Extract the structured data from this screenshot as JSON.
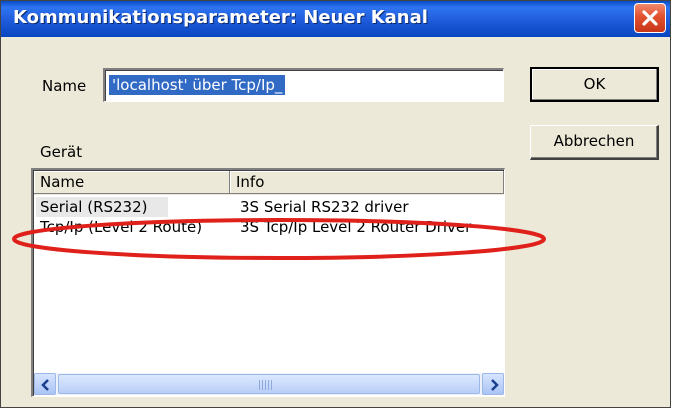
{
  "window": {
    "title": "Kommunikationsparameter: Neuer Kanal",
    "close_icon": "close-x-icon"
  },
  "form": {
    "name_label": "Name",
    "name_value": "'localhost' über Tcp/Ip_",
    "device_label": "Gerät"
  },
  "buttons": {
    "ok": "OK",
    "cancel": "Abbrechen"
  },
  "device_list": {
    "columns": [
      "Name",
      "Info"
    ],
    "rows": [
      {
        "name": "Serial (RS232)",
        "info": "3S Serial RS232 driver"
      },
      {
        "name": "Tcp/Ip (Level 2 Route)",
        "info": "3S Tcp/Ip Level 2 Router Driver"
      }
    ]
  },
  "annotation": {
    "color": "#E0201A",
    "highlighted_row": 1
  }
}
